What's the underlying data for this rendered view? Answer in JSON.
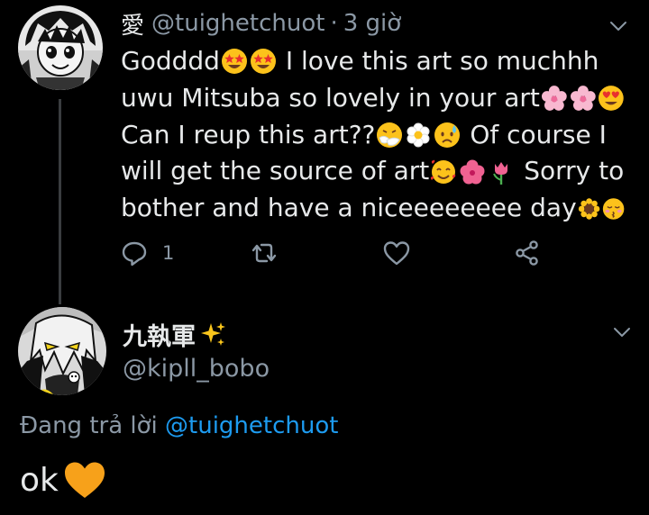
{
  "tweet": {
    "name": "愛",
    "handle": "@tuighetchuot",
    "separator": "·",
    "time": "3 giờ",
    "lines": [
      [
        "Godddd",
        "star-struck",
        "star-struck",
        " I love this art so muchhh"
      ],
      [
        "uwu Mitsuba so lovely in your art",
        "cherry-blossom",
        "cherry-blossom",
        "heart-eyes"
      ],
      [
        "Can I reup this art??",
        "sneezing-face",
        "white-flower",
        "worried-sweat",
        " Of course I"
      ],
      [
        "will get the source of art",
        "smiling-hearts",
        "hibiscus",
        "tulip",
        " Sorry to"
      ],
      [
        "bother and have a niceeeeeeee day",
        "sunflower",
        "kissing-blush"
      ]
    ],
    "actions": {
      "reply_count": "1"
    },
    "icons": {
      "reply": "reply-icon",
      "retweet": "retweet-icon",
      "like": "like-icon",
      "share": "share-icon",
      "menu": "chevron-down-icon"
    }
  },
  "reply": {
    "name": "九執軍",
    "name_emoji": "sparkles",
    "handle": "@kipll_bobo",
    "replying_prefix": "Đang trả lời",
    "replying_to": "@tuighetchuot",
    "text": "ok",
    "text_emoji": "orange-heart"
  },
  "colors": {
    "background": "#000000",
    "text": "#e7e9ea",
    "secondary": "#8b98a5",
    "link": "#1d9bf0",
    "thread_line": "#3a3d40",
    "heart": "#f7a11a"
  }
}
